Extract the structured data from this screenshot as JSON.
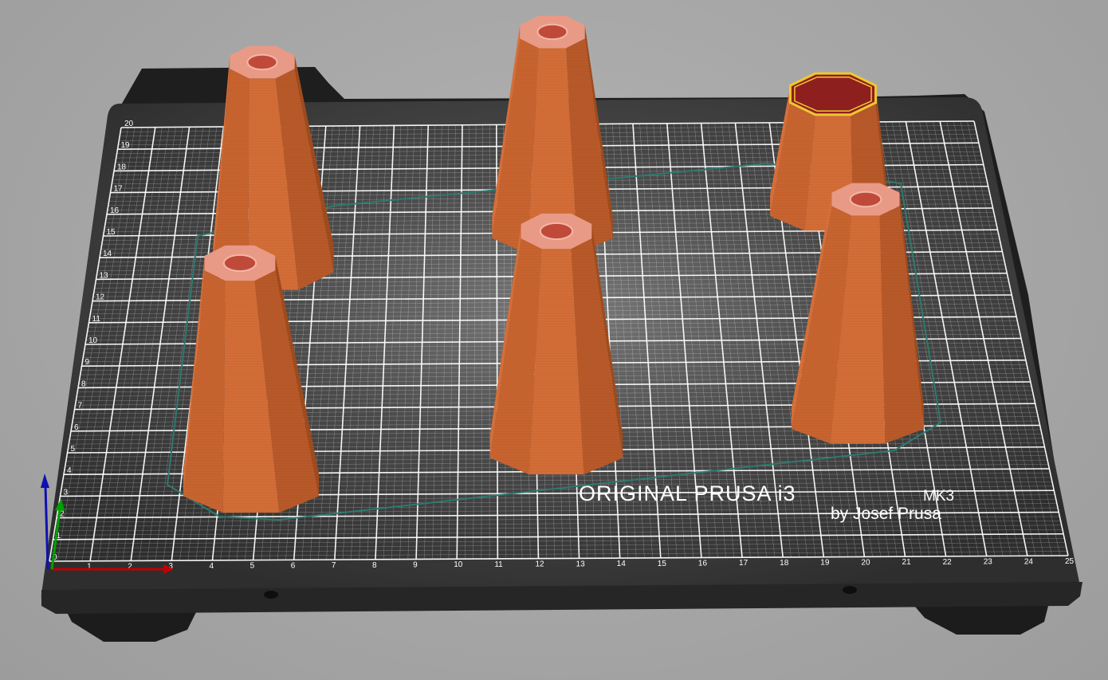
{
  "bed": {
    "brand_line1": "ORIGINAL PRUSA i3",
    "brand_model": "MK3",
    "brand_line2": "by Josef Prusa",
    "x_ticks": [
      "0",
      "1",
      "2",
      "3",
      "4",
      "5",
      "6",
      "7",
      "8",
      "9",
      "10",
      "11",
      "12",
      "13",
      "14",
      "15",
      "16",
      "17",
      "18",
      "19",
      "20",
      "21",
      "22",
      "23",
      "24",
      "25"
    ],
    "y_ticks": [
      "0",
      "1",
      "2",
      "3",
      "4",
      "5",
      "6",
      "7",
      "8",
      "9",
      "10",
      "11",
      "12",
      "13",
      "14",
      "15",
      "16",
      "17",
      "18",
      "19",
      "20"
    ]
  },
  "objects": [
    {
      "name": "cone-back-left",
      "state": "sliced"
    },
    {
      "name": "cone-back-center",
      "state": "sliced"
    },
    {
      "name": "cone-back-right",
      "state": "selected"
    },
    {
      "name": "cone-front-left",
      "state": "sliced"
    },
    {
      "name": "cone-front-center",
      "state": "sliced"
    },
    {
      "name": "cone-front-right",
      "state": "sliced"
    }
  ],
  "colors": {
    "background": "#a8a8a8",
    "bed_plate": "#2f2f2f",
    "grid": "#ffffff",
    "object_side": "#d0692e",
    "object_top": "#e8988a",
    "selection_outline": "#f0c830",
    "skirt": "#2e6e62",
    "axis_x": "#c00000",
    "axis_y": "#00a000",
    "axis_z": "#1010b0"
  },
  "axes": {
    "x": "X",
    "y": "Y",
    "z": "Z"
  }
}
